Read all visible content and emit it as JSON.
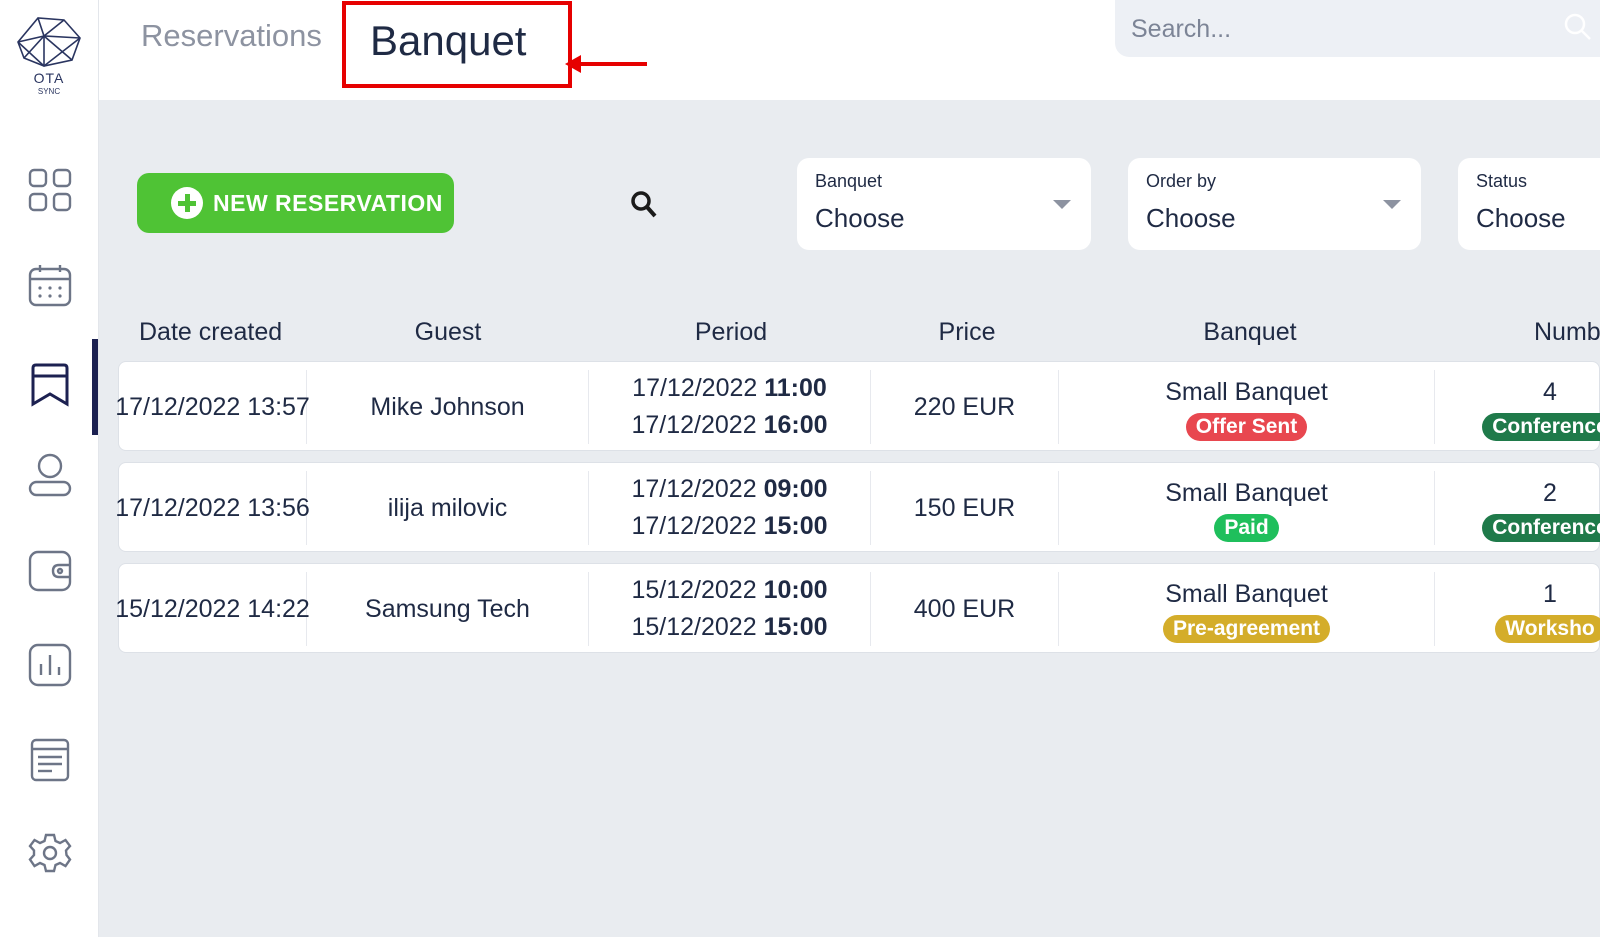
{
  "brand": {
    "name": "OTA",
    "sub": "SYNC"
  },
  "sidebar": {
    "items": [
      {
        "id": "dashboard",
        "icon": "grid-icon"
      },
      {
        "id": "calendar",
        "icon": "calendar-icon"
      },
      {
        "id": "reservations",
        "icon": "bookmark-icon",
        "active": true
      },
      {
        "id": "guests",
        "icon": "user-icon"
      },
      {
        "id": "wallet",
        "icon": "wallet-icon"
      },
      {
        "id": "reports",
        "icon": "bar-chart-icon"
      },
      {
        "id": "documents",
        "icon": "document-icon"
      },
      {
        "id": "settings",
        "icon": "gear-icon"
      }
    ]
  },
  "header": {
    "breadcrumb": "Reservations",
    "title": "Banquet",
    "search_placeholder": "Search..."
  },
  "toolbar": {
    "new_button": "NEW RESERVATION",
    "filters": [
      {
        "label": "Banquet",
        "value": "Choose"
      },
      {
        "label": "Order by",
        "value": "Choose"
      },
      {
        "label": "Status",
        "value": "Choose"
      }
    ]
  },
  "table": {
    "columns": [
      "Date created",
      "Guest",
      "Period",
      "Price",
      "Banquet",
      "Numb"
    ],
    "rows": [
      {
        "date_created": "17/12/2022 13:57",
        "guest": "Mike Johnson",
        "period_start_date": "17/12/2022",
        "period_start_time": "11:00",
        "period_end_date": "17/12/2022",
        "period_end_time": "16:00",
        "price": "220 EUR",
        "banquet": "Small Banquet",
        "status": "Offer Sent",
        "number": "4",
        "type": "Conference"
      },
      {
        "date_created": "17/12/2022 13:56",
        "guest": "ilija milovic",
        "period_start_date": "17/12/2022",
        "period_start_time": "09:00",
        "period_end_date": "17/12/2022",
        "period_end_time": "15:00",
        "price": "150 EUR",
        "banquet": "Small Banquet",
        "status": "Paid",
        "number": "2",
        "type": "Conference"
      },
      {
        "date_created": "15/12/2022 14:22",
        "guest": "Samsung Tech",
        "period_start_date": "15/12/2022",
        "period_start_time": "10:00",
        "period_end_date": "15/12/2022",
        "period_end_time": "15:00",
        "price": "400 EUR",
        "banquet": "Small Banquet",
        "status": "Pre-agreement",
        "number": "1",
        "type": "Worksho"
      }
    ]
  },
  "colors": {
    "accent_green": "#4fc335",
    "status_offer_sent": "#e8474f",
    "status_paid": "#1fbf5c",
    "status_pre_agreement": "#d4ad2a",
    "type_conference": "#1f7a4a",
    "type_workshop": "#d4ad2a",
    "annotation_red": "#e60000",
    "nav_active": "#1c2151"
  }
}
